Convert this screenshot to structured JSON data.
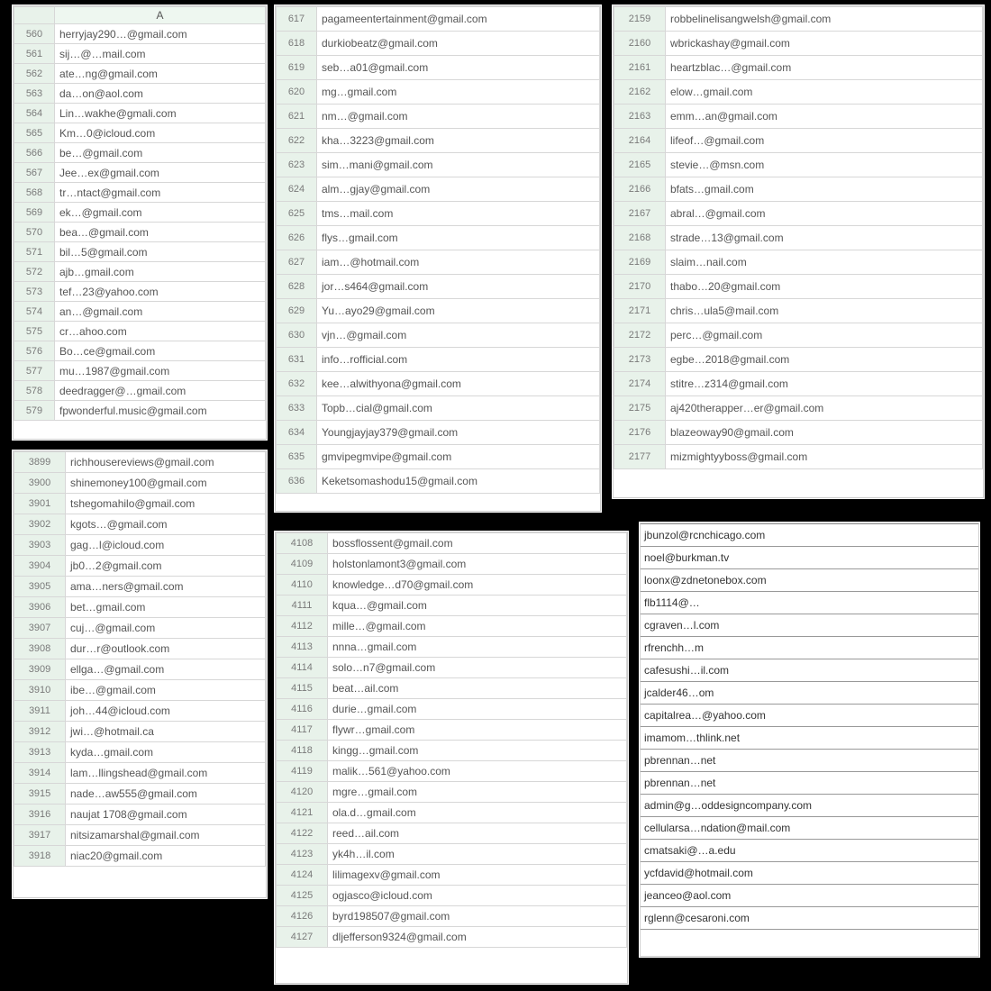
{
  "note": "All personal data below is obscured/redacted approximations of a screenshot; values are placeholders, not real addresses.",
  "p1": {
    "header": "A",
    "rows": [
      {
        "n": "560",
        "v": "herryjay290…@gmail.com"
      },
      {
        "n": "561",
        "v": "sij…@…mail.com"
      },
      {
        "n": "562",
        "v": "ate…ng@gmail.com"
      },
      {
        "n": "563",
        "v": "da…on@aol.com"
      },
      {
        "n": "564",
        "v": "Lin…wakhe@gmali.com"
      },
      {
        "n": "565",
        "v": "Km…0@icloud.com"
      },
      {
        "n": "566",
        "v": "be…@gmail.com"
      },
      {
        "n": "567",
        "v": "Jee…ex@gmail.com"
      },
      {
        "n": "568",
        "v": "tr…ntact@gmail.com"
      },
      {
        "n": "569",
        "v": "ek…@gmail.com"
      },
      {
        "n": "570",
        "v": "bea…@gmail.com"
      },
      {
        "n": "571",
        "v": "bil…5@gmail.com"
      },
      {
        "n": "572",
        "v": "ajb…gmail.com"
      },
      {
        "n": "573",
        "v": "tef…23@yahoo.com"
      },
      {
        "n": "574",
        "v": "an…@gmail.com"
      },
      {
        "n": "575",
        "v": "cr…ahoo.com"
      },
      {
        "n": "576",
        "v": "Bo…ce@gmail.com"
      },
      {
        "n": "577",
        "v": "mu…1987@gmail.com"
      },
      {
        "n": "578",
        "v": "deedragger@…gmail.com"
      },
      {
        "n": "579",
        "v": "fpwonderful.music@gmail.com"
      }
    ]
  },
  "p2": {
    "rows": [
      {
        "n": "617",
        "v": "pagameentertainment@gmail.com"
      },
      {
        "n": "618",
        "v": "durkiobeatz@gmail.com"
      },
      {
        "n": "619",
        "v": "seb…a01@gmail.com"
      },
      {
        "n": "620",
        "v": "mg…gmail.com"
      },
      {
        "n": "621",
        "v": "nm…@gmail.com"
      },
      {
        "n": "622",
        "v": "kha…3223@gmail.com"
      },
      {
        "n": "623",
        "v": "sim…mani@gmail.com"
      },
      {
        "n": "624",
        "v": "alm…gjay@gmail.com"
      },
      {
        "n": "625",
        "v": "tms…mail.com"
      },
      {
        "n": "626",
        "v": "flys…gmail.com"
      },
      {
        "n": "627",
        "v": "iam…@hotmail.com"
      },
      {
        "n": "628",
        "v": "jor…s464@gmail.com"
      },
      {
        "n": "629",
        "v": "Yu…ayo29@gmail.com"
      },
      {
        "n": "630",
        "v": "vjn…@gmail.com"
      },
      {
        "n": "631",
        "v": "info…rofficial.com"
      },
      {
        "n": "632",
        "v": "kee…alwithyona@gmail.com"
      },
      {
        "n": "633",
        "v": "Topb…cial@gmail.com"
      },
      {
        "n": "634",
        "v": "Youngjayjay379@gmail.com"
      },
      {
        "n": "635",
        "v": "gmvipegmvipe@gmail.com"
      },
      {
        "n": "636",
        "v": "Keketsomashodu15@gmail.com"
      }
    ]
  },
  "p3": {
    "rows": [
      {
        "n": "2159",
        "v": "robbelinelisangwelsh@gmail.com"
      },
      {
        "n": "2160",
        "v": "wbrickashay@gmail.com"
      },
      {
        "n": "2161",
        "v": "heartzblac…@gmail.com"
      },
      {
        "n": "2162",
        "v": "elow…gmail.com"
      },
      {
        "n": "2163",
        "v": "emm…an@gmail.com"
      },
      {
        "n": "2164",
        "v": "lifeof…@gmail.com"
      },
      {
        "n": "2165",
        "v": "stevie…@msn.com"
      },
      {
        "n": "2166",
        "v": "bfats…gmail.com"
      },
      {
        "n": "2167",
        "v": "abral…@gmail.com"
      },
      {
        "n": "2168",
        "v": "strade…13@gmail.com"
      },
      {
        "n": "2169",
        "v": "slaim…nail.com"
      },
      {
        "n": "2170",
        "v": "thabo…20@gmail.com"
      },
      {
        "n": "2171",
        "v": "chris…ula5@mail.com"
      },
      {
        "n": "2172",
        "v": "perc…@gmail.com"
      },
      {
        "n": "2173",
        "v": "egbe…2018@gmail.com"
      },
      {
        "n": "2174",
        "v": "stitre…z314@gmail.com"
      },
      {
        "n": "2175",
        "v": "aj420therapper…er@gmail.com"
      },
      {
        "n": "2176",
        "v": "blazeoway90@gmail.com"
      },
      {
        "n": "2177",
        "v": "mizmightyyboss@gmail.com"
      }
    ]
  },
  "p4": {
    "rows": [
      {
        "n": "3899",
        "v": "richhousereviews@gmail.com"
      },
      {
        "n": "3900",
        "v": "shinemoney100@gmail.com"
      },
      {
        "n": "3901",
        "v": "tshegomahilo@gmail.com"
      },
      {
        "n": "3902",
        "v": "kgots…@gmail.com"
      },
      {
        "n": "3903",
        "v": "gag…l@icloud.com"
      },
      {
        "n": "3904",
        "v": "jb0…2@gmail.com"
      },
      {
        "n": "3905",
        "v": "ama…ners@gmail.com"
      },
      {
        "n": "3906",
        "v": "bet…gmail.com"
      },
      {
        "n": "3907",
        "v": "cuj…@gmail.com"
      },
      {
        "n": "3908",
        "v": "dur…r@outlook.com"
      },
      {
        "n": "3909",
        "v": "ellga…@gmail.com"
      },
      {
        "n": "3910",
        "v": "ibe…@gmail.com"
      },
      {
        "n": "3911",
        "v": "joh…44@icloud.com"
      },
      {
        "n": "3912",
        "v": "jwi…@hotmail.ca"
      },
      {
        "n": "3913",
        "v": "kyda…gmail.com"
      },
      {
        "n": "3914",
        "v": "lam…llingshead@gmail.com"
      },
      {
        "n": "3915",
        "v": "nade…aw555@gmail.com"
      },
      {
        "n": "3916",
        "v": "naujat 1708@gmail.com"
      },
      {
        "n": "3917",
        "v": "nitsizamarshal@gmail.com"
      },
      {
        "n": "3918",
        "v": "niac20@gmail.com"
      }
    ]
  },
  "p5": {
    "rows": [
      {
        "n": "4108",
        "v": "bossflossent@gmail.com"
      },
      {
        "n": "4109",
        "v": "holstonlamont3@gmail.com"
      },
      {
        "n": "4110",
        "v": "knowledge…d70@gmail.com"
      },
      {
        "n": "4111",
        "v": "kqua…@gmail.com"
      },
      {
        "n": "4112",
        "v": "mille…@gmail.com"
      },
      {
        "n": "4113",
        "v": "nnna…gmail.com"
      },
      {
        "n": "4114",
        "v": "solo…n7@gmail.com"
      },
      {
        "n": "4115",
        "v": "beat…ail.com"
      },
      {
        "n": "4116",
        "v": "durie…gmail.com"
      },
      {
        "n": "4117",
        "v": "flywr…gmail.com"
      },
      {
        "n": "4118",
        "v": "kingg…gmail.com"
      },
      {
        "n": "4119",
        "v": "malik…561@yahoo.com"
      },
      {
        "n": "4120",
        "v": "mgre…gmail.com"
      },
      {
        "n": "4121",
        "v": "ola.d…gmail.com"
      },
      {
        "n": "4122",
        "v": "reed…ail.com"
      },
      {
        "n": "4123",
        "v": "yk4h…il.com"
      },
      {
        "n": "4124",
        "v": "lilimagexv@gmail.com"
      },
      {
        "n": "4125",
        "v": "ogjasco@icloud.com"
      },
      {
        "n": "4126",
        "v": "byrd198507@gmail.com"
      },
      {
        "n": "4127",
        "v": "dljefferson9324@gmail.com"
      }
    ]
  },
  "p6": {
    "rows": [
      "jbunzol@rcnchicago.com",
      "noel@burkman.tv",
      "loonx@zdnetonebox.com",
      "flb1114@…",
      "cgraven…l.com",
      "rfrenchh…m",
      "cafesushi…il.com",
      "jcalder46…om",
      "capitalrea…@yahoo.com",
      "imamom…thlink.net",
      "pbrennan…net",
      "pbrennan…net",
      "admin@g…oddesigncompany.com",
      "cellularsa…ndation@mail.com",
      "cmatsaki@…a.edu",
      "ycfdavid@hotmail.com",
      "jeanceo@aol.com",
      "rglenn@cesaroni.com"
    ]
  }
}
